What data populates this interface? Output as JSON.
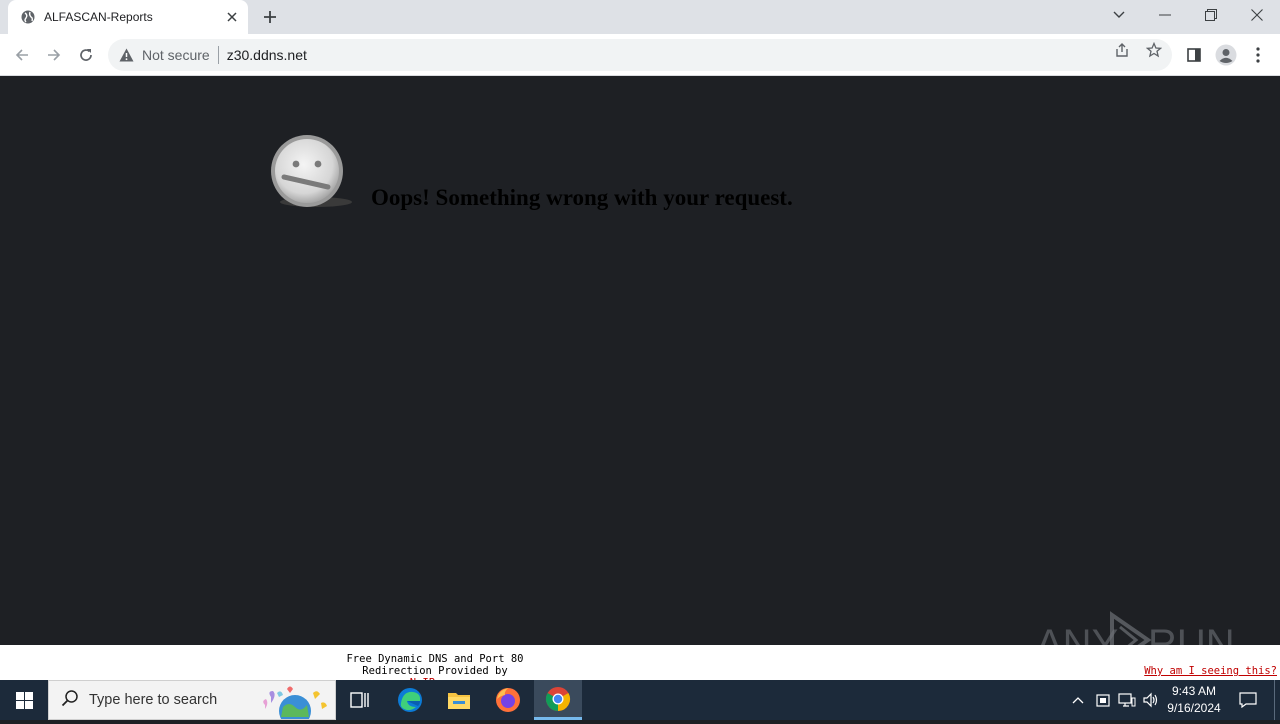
{
  "browser": {
    "tab_title": "ALFASCAN-Reports",
    "security_label": "Not secure",
    "url": "z30.ddns.net"
  },
  "page": {
    "error_message": "Oops! Something wrong with your request."
  },
  "footer": {
    "line1": "Free Dynamic DNS and Port 80",
    "line2_prefix": "Redirection Provided by ",
    "link": "NoIP.com",
    "why": "Why am I seeing this?"
  },
  "watermark": {
    "text_left": "ANY",
    "text_right": "RUN"
  },
  "taskbar": {
    "search_placeholder": "Type here to search",
    "time": "9:43 AM",
    "date": "9/16/2024"
  },
  "colors": {
    "page_background": "#1e2024",
    "taskbar": "#1c2a3a",
    "link_red": "#c00000"
  }
}
